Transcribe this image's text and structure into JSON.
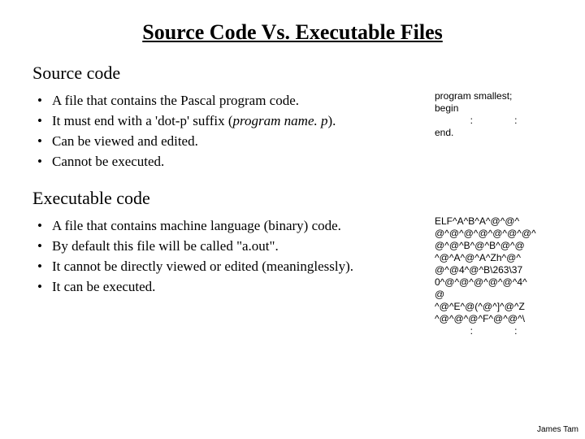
{
  "title": "Source Code Vs. Executable Files",
  "section1": {
    "heading": "Source code",
    "bullets": [
      "A file that contains the Pascal program code.",
      "It must end with a 'dot-p' suffix (",
      "Can be viewed and edited.",
      "Cannot be executed."
    ],
    "bullet2_italic": "program name. p",
    "bullet2_tail": ").",
    "code": {
      "line1": "program smallest;",
      "line2": "begin",
      "line3": "end."
    }
  },
  "section2": {
    "heading": "Executable code",
    "bullets": [
      "A file that contains machine language (binary) code.",
      "By default this file will be called \"a.out\".",
      "It cannot be directly viewed or edited (meaninglessly).",
      "It can be executed."
    ],
    "code": {
      "line1": "ELF^A^B^A^@^@^",
      "line2": "@^@^@^@^@^@^@^",
      "line3": "@^@^B^@^B^@^@",
      "line4": "^@^A^@^A^Zh^@^",
      "line5": "@^@4^@^B\\263\\37",
      "line6": "0^@^@^@^@^@^4^",
      "line7": "@",
      "line8": "^@^E^@(^@^]^@^Z",
      "line9": "^@^@^@^F^@^@^\\"
    }
  },
  "footer": "James Tam"
}
